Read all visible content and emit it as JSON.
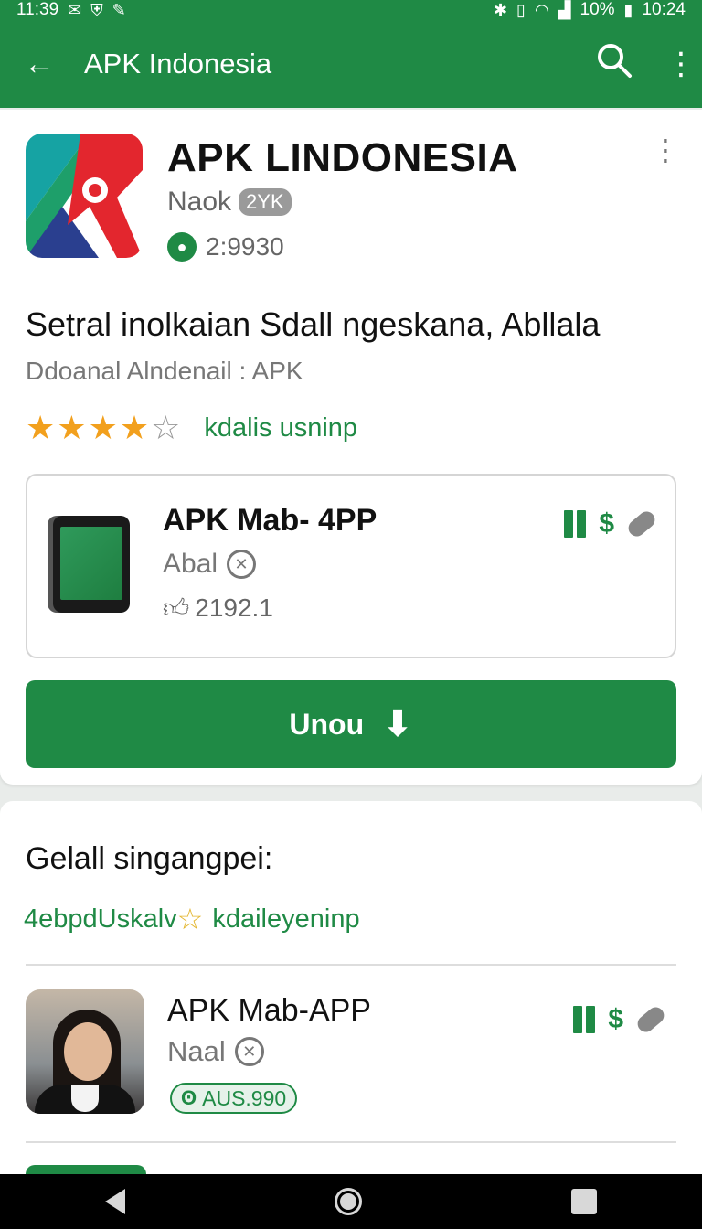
{
  "status_bar": {
    "time": "11:39",
    "battery": "10%",
    "clock_right": "10:24"
  },
  "app_bar": {
    "title": "APK Indonesia"
  },
  "app": {
    "name": "APK LINDONESIA",
    "developer": "Naok",
    "developer_badge": "2YK",
    "downloads": "2:9930"
  },
  "description": {
    "headline": "Setral inolkaian Sdall ngeskana, Abllala",
    "subline": "Ddoanal Alndenail : APK",
    "rating_value": 3.5,
    "rating_max": 5,
    "rating_link": "kdalis usninp"
  },
  "feature": {
    "title": "APK Mab- 4PP",
    "subtitle": "Abal",
    "count": "2192.1"
  },
  "install_button": {
    "label": "Unou"
  },
  "section": {
    "title": "Gelall singangpei:",
    "link_left": "4ebpdUskalv",
    "link_right": "kdaileyeninp"
  },
  "list_item": {
    "title": "APK Mab-APP",
    "subtitle": "Naal",
    "price": "AUS.990"
  },
  "colors": {
    "brand_green": "#1f8a45",
    "star_orange": "#f2a01d"
  }
}
